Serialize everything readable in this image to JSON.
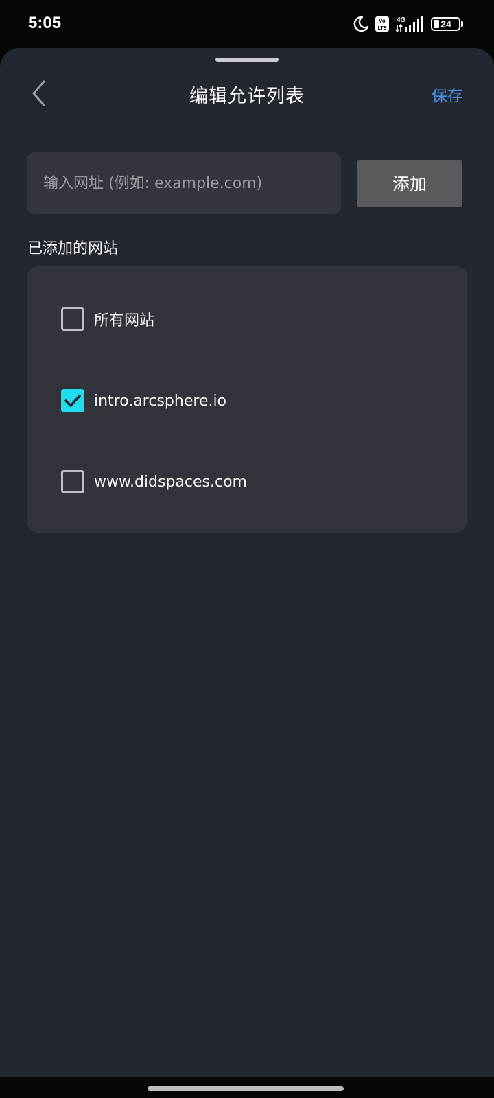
{
  "status_bar": {
    "time": "5:05",
    "volte_label": "Vo LTE",
    "network": "4G",
    "battery": "24"
  },
  "header": {
    "title": "编辑允许列表",
    "save_label": "保存"
  },
  "url_input": {
    "placeholder": "输入网址 (例如: example.com)",
    "value": ""
  },
  "add_button_label": "添加",
  "section_label": "已添加的网站",
  "sites": [
    {
      "label": "所有网站",
      "checked": false
    },
    {
      "label": "intro.arcsphere.io",
      "checked": true
    },
    {
      "label": "www.didspaces.com",
      "checked": false
    }
  ],
  "colors": {
    "accent": "#4c93e8",
    "checkbox_checked": "#1fdcf0",
    "background": "#232730",
    "card": "#31343a"
  }
}
